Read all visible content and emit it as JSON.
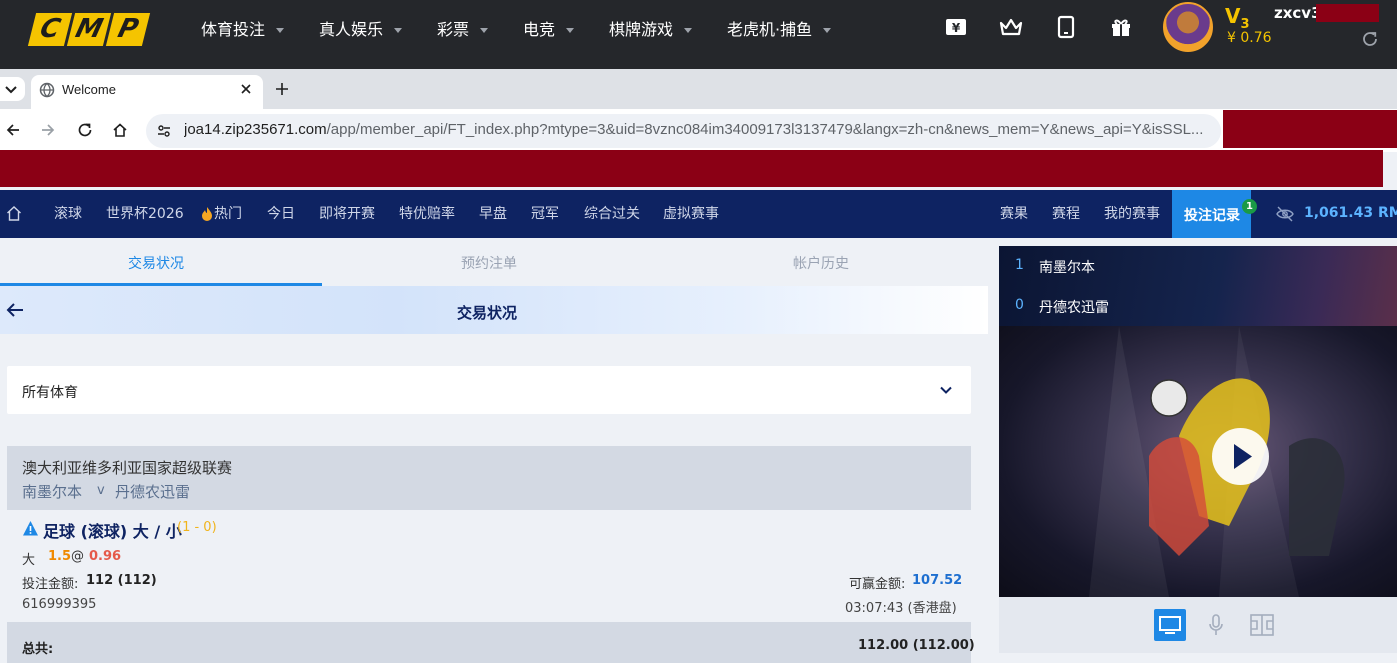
{
  "site": {
    "logo_letters": [
      "C",
      "M",
      "P"
    ],
    "menu": [
      {
        "label": "体育投注"
      },
      {
        "label": "真人娱乐"
      },
      {
        "label": "彩票"
      },
      {
        "label": "电竞"
      },
      {
        "label": "棋牌游戏"
      },
      {
        "label": "老虎机·捕鱼"
      }
    ],
    "icons": [
      "yuan-icon",
      "crown-icon",
      "mobile-icon",
      "gift-icon"
    ],
    "vip_level": "V",
    "vip_num": "3",
    "balance": "¥ 0.76",
    "username": "zxcv3"
  },
  "browser": {
    "tab_title": "Welcome",
    "url_host": "joa14.zip235671.com",
    "url_rest": "/app/member_api/FT_index.php?mtype=3&uid=8vznc084im34009173l3137479&langx=zh-cn&news_mem=Y&news_api=Y&isSSL..."
  },
  "sports_nav": {
    "items": [
      "滚球",
      "世界杯2026",
      "热门",
      "今日",
      "即将开赛",
      "特优赔率",
      "早盘",
      "冠军",
      "综合过关",
      "虚拟赛事"
    ],
    "right_items": [
      "赛果",
      "赛程",
      "我的赛事"
    ],
    "bet_log": "投注记录",
    "bet_log_badge": "1",
    "balance": "1,061.43",
    "currency": "RMB"
  },
  "subtabs": [
    "交易状况",
    "预约注单",
    "帐户历史"
  ],
  "section_title": "交易状况",
  "sport_filter": "所有体育",
  "bet": {
    "league": "澳大利亚维多利亚国家超级联赛",
    "home": "南墨尔本",
    "vs": "v",
    "away": "丹德农迅雷",
    "market": "足球 (滚球) 大 / 小",
    "score": "(1 - 0)",
    "selection": "大",
    "line": "1.5",
    "at": "@",
    "odds": "0.96",
    "stake_label": "投注金额:",
    "stake": "112 (112)",
    "win_label": "可赢金额:",
    "win": "107.52",
    "ticket_id": "616999395",
    "time": "03:07:43 (香港盘)"
  },
  "total": {
    "label": "总共:",
    "value": "112.00 (112.00)"
  },
  "live": {
    "home_score": "1",
    "home": "南墨尔本",
    "away_score": "0",
    "away": "丹德农迅雷"
  },
  "colors": {
    "accent": "#1e88e5",
    "nav_dark": "#0e2362",
    "logo_yellow": "#f5c400",
    "mask_red": "#8b0015"
  }
}
